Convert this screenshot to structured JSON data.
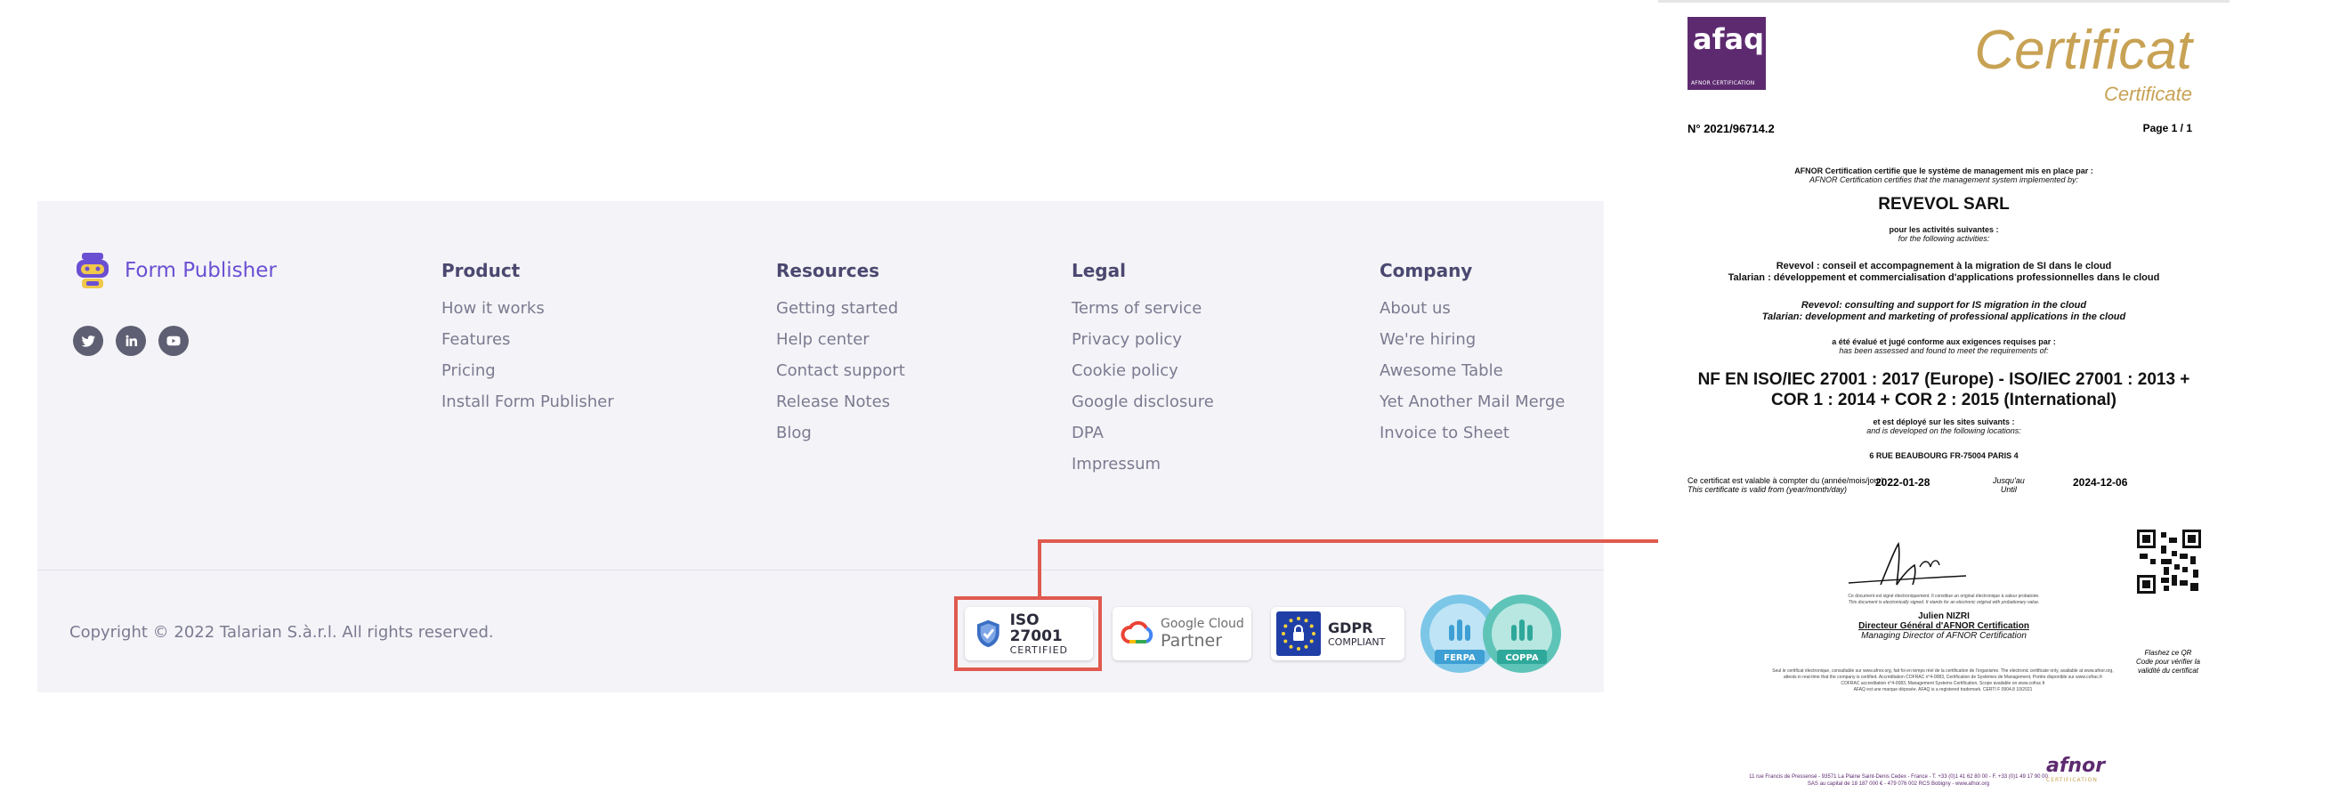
{
  "brand": {
    "name": "Form Publisher"
  },
  "social": {
    "icons": [
      "twitter-icon",
      "linkedin-icon",
      "youtube-icon"
    ]
  },
  "columns": [
    {
      "title": "Product",
      "items": [
        "How it works",
        "Features",
        "Pricing",
        "Install Form Publisher"
      ]
    },
    {
      "title": "Resources",
      "items": [
        "Getting started",
        "Help center",
        "Contact support",
        "Release Notes",
        "Blog"
      ]
    },
    {
      "title": "Legal",
      "items": [
        "Terms of service",
        "Privacy policy",
        "Cookie policy",
        "Google disclosure",
        "DPA",
        "Impressum"
      ]
    },
    {
      "title": "Company",
      "items": [
        "About us",
        "We're hiring",
        "Awesome Table",
        "Yet Another Mail Merge",
        "Invoice to Sheet"
      ]
    }
  ],
  "copyright": "Copyright © 2022 Talarian S.à.r.l. All rights reserved.",
  "badges": {
    "iso": {
      "line1": "ISO 27001",
      "line2": "CERTIFIED"
    },
    "gcp": {
      "line1": "Google Cloud",
      "line2": "Partner"
    },
    "gdpr": {
      "line1": "GDPR",
      "line2": "COMPLIANT"
    },
    "ferpa": {
      "label": "FERPA"
    },
    "coppa": {
      "label": "COPPA"
    }
  },
  "colors": {
    "accent": "#6b4fd3",
    "highlight": "#e05a4f",
    "gold": "#c8a254",
    "afnor_purple": "#5d2a70"
  },
  "certificate": {
    "logo_text": "afaq",
    "logo_sub": "AFNOR CERTIFICATION",
    "title": "Certificat",
    "subtitle": "Certificate",
    "number": "N° 2021/96714.2",
    "page": "Page 1 / 1",
    "intro_fr": "AFNOR Certification certifie que le système de management mis en place par :",
    "intro_en": "AFNOR Certification certifies that the management system implemented by:",
    "company": "REVEVOL SARL",
    "activities_fr": "pour les activités suivantes :",
    "activities_en": "for the following activities:",
    "act_fr_1": "Revevol : conseil et accompagnement à la migration de SI dans le cloud",
    "act_fr_2": "Talarian : développement et commercialisation d'applications professionnelles dans le cloud",
    "act_en_1": "Revevol: consulting and support for IS migration in the cloud",
    "act_en_2": "Talarian: development and marketing of professional applications in the cloud",
    "assessed_fr": "a été évalué et jugé conforme aux exigences requises par :",
    "assessed_en": "has been assessed and found to meet the requirements of:",
    "standard_1": "NF EN ISO/IEC 27001 : 2017 (Europe) - ISO/IEC 27001 : 2013 +",
    "standard_2": "COR 1 : 2014 + COR 2 : 2015 (International)",
    "deployed_fr": "et est déployé sur les sites suivants :",
    "deployed_en": "and is developed on the following locations:",
    "address": "6 RUE BEAUBOURG   FR-75004 PARIS 4",
    "valid_fr": "Ce certificat est valable à compter du (année/mois/jour)",
    "valid_en": "This certificate is valid from (year/month/day)",
    "valid_from": "2022-01-28",
    "until_fr": "Jusqu'au",
    "until_en": "Until",
    "valid_until": "2024-12-06",
    "e_sign_fr": "Ce document est signé électroniquement. Il constitue un original électronique à valeur probatoire.",
    "e_sign_en": "This document is electronically signed. It stands for an electronic original with probationary value.",
    "signer": "Julien NIZRI",
    "signer_title_fr": "Directeur Général d'AFNOR Certification",
    "signer_title_en": "Managing Director of AFNOR Certification",
    "flash_1": "Flashez ce QR",
    "flash_2": "Code pour vérifier la",
    "flash_3": "validité du certificat",
    "fine_1": "Seul le certificat électronique, consultable sur www.afnor.org, fait foi en temps réel de la certification de l'organisme. The electronic certificate only, available at www.afnor.org,",
    "fine_2": "attests in real-time that the company is certified. Accréditation COFRAC n°4-0083, Certification de Systèmes de Management, Portée disponible sur www.cofrac.fr",
    "fine_3": "COFRAC accreditation n°4-0083, Management Systems Certification, Scope available on www.cofrac.fr",
    "fine_4": "AFAQ est une marque déposée. AFAQ is a registered trademark. CERTI F 0904.8 10/2021",
    "afnor_logo": "afnor",
    "afnor_logo_sub": "CERTIFICATION",
    "addr_1": "11 rue Francis de Pressensé - 93571 La Plaine Saint-Denis Cedex - France - T. +33 (0)1 41 62 80 00 - F. +33 (0)1 49 17 90 00",
    "addr_2": "SAS au capital de 18 187 000 € - 479 076 002 RCS Bobigny - www.afnor.org"
  }
}
